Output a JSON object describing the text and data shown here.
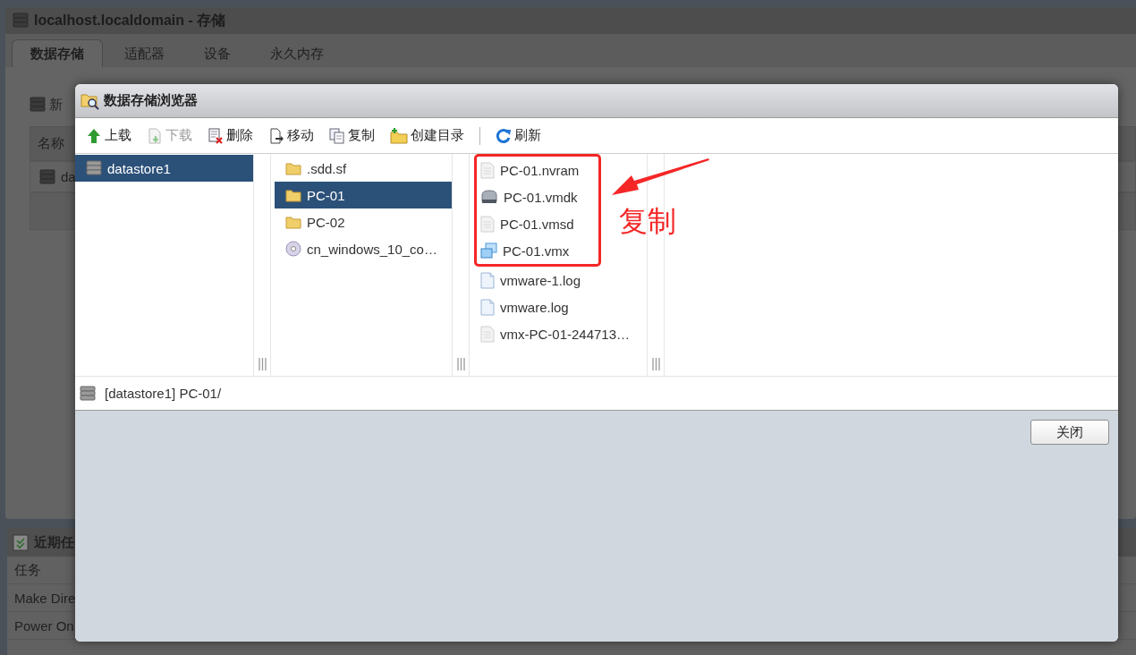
{
  "app_window": {
    "title": "localhost.localdomain - 存储",
    "tabs": [
      {
        "label": "数据存储",
        "selected": true
      },
      {
        "label": "适配器",
        "selected": false
      },
      {
        "label": "设备",
        "selected": false
      },
      {
        "label": "永久内存",
        "selected": false
      }
    ],
    "toolbar_text": "新",
    "table_header": "名称",
    "table_cell": "da"
  },
  "tasks_panel": {
    "title": "近期任",
    "header": "任务",
    "rows": [
      "Make Dire",
      "Power On"
    ]
  },
  "dialog": {
    "title": "数据存储浏览器",
    "toolbar": [
      {
        "kind": "upload",
        "label": "上载",
        "disabled": false
      },
      {
        "kind": "download",
        "label": "下载",
        "disabled": true
      },
      {
        "kind": "delete",
        "label": "删除",
        "disabled": false
      },
      {
        "kind": "move",
        "label": "移动",
        "disabled": false
      },
      {
        "kind": "copy",
        "label": "复制",
        "disabled": false
      },
      {
        "kind": "mkdir",
        "label": "创建目录",
        "disabled": false
      },
      {
        "kind": "separator"
      },
      {
        "kind": "refresh",
        "label": "刷新",
        "disabled": false
      }
    ],
    "datastores": [
      {
        "name": "datastore1",
        "selected": true
      }
    ],
    "folders": [
      {
        "kind": "folder",
        "name": ".sdd.sf",
        "selected": false
      },
      {
        "kind": "folder",
        "name": "PC-01",
        "selected": true
      },
      {
        "kind": "folder",
        "name": "PC-02",
        "selected": false
      },
      {
        "kind": "disc",
        "name": "cn_windows_10_co…",
        "selected": false
      }
    ],
    "files": [
      {
        "kind": "file",
        "name": "PC-01.nvram",
        "highlighted": true
      },
      {
        "kind": "disk",
        "name": "PC-01.vmdk",
        "highlighted": true
      },
      {
        "kind": "file",
        "name": "PC-01.vmsd",
        "highlighted": true
      },
      {
        "kind": "vm",
        "name": "PC-01.vmx",
        "highlighted": true
      },
      {
        "kind": "log",
        "name": "vmware-1.log",
        "highlighted": false
      },
      {
        "kind": "log",
        "name": "vmware.log",
        "highlighted": false
      },
      {
        "kind": "file",
        "name": "vmx-PC-01-244713…",
        "highlighted": false
      }
    ],
    "path": "[datastore1] PC-01/",
    "buttons": [
      "关闭"
    ]
  },
  "annotation": {
    "label": "复制"
  }
}
